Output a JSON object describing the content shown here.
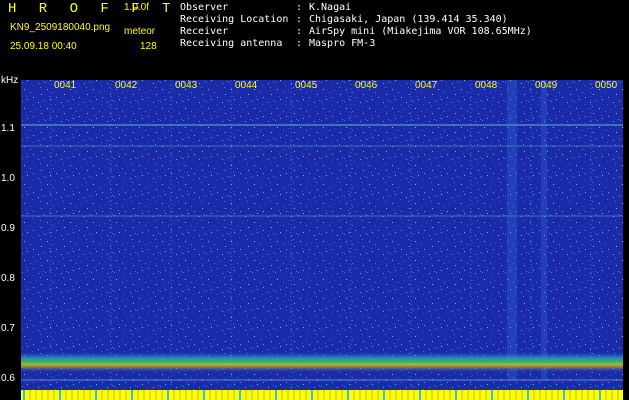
{
  "header": {
    "app_title": "H R O F F T",
    "version": "1.0.0f",
    "filename": "KN9_2509180040.png",
    "mode": "meteor",
    "datetime": "25.09.18 00:40",
    "fft_size": "128"
  },
  "station": [
    {
      "label": "Observer",
      "value": "K.Nagai"
    },
    {
      "label": "Receiving Location",
      "value": "Chigasaki, Japan (139.414 35.340)"
    },
    {
      "label": "Receiver",
      "value": "AirSpy mini (Miakejima VOR 108.65MHz)"
    },
    {
      "label": "Receiving antenna",
      "value": "Maspro FM-3"
    }
  ],
  "axis": {
    "unit": "kHz",
    "freq_ticks": [
      "1.1",
      "1.0",
      "0.9",
      "0.8",
      "0.7",
      "0.6"
    ],
    "freq_values": [
      1.1,
      1.0,
      0.9,
      0.8,
      0.7,
      0.6
    ],
    "time_ticks": [
      "0041",
      "0042",
      "0043",
      "0044",
      "0045",
      "0046",
      "0047",
      "0048",
      "0049",
      "0050"
    ],
    "freq_range": [
      0.575,
      1.165
    ]
  },
  "colors": {
    "background_noise": "#1c2cb4",
    "header_text": "#ffff00",
    "label_text": "#ffffff",
    "carrier_band": "#20b040",
    "bottom_bar": "#ffff00"
  }
}
